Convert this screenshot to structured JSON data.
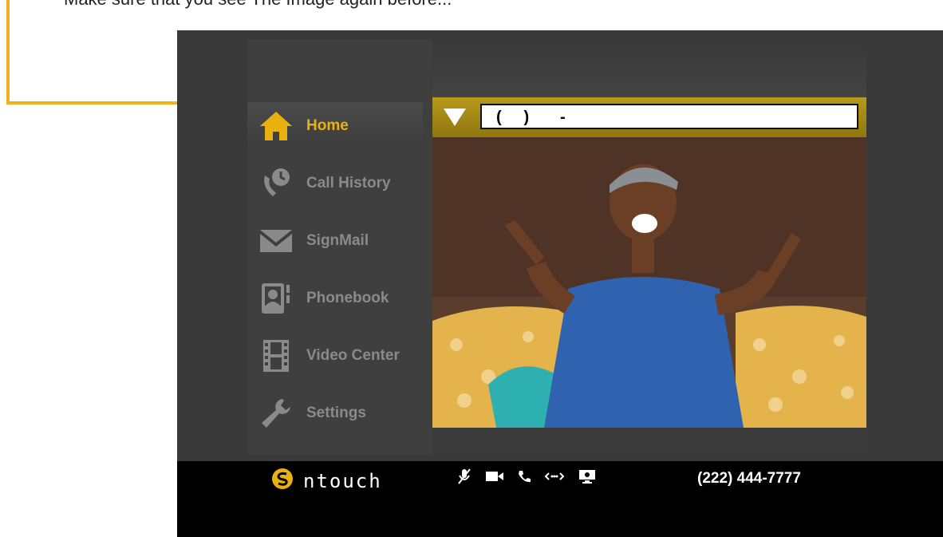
{
  "caption": {
    "text": "Make sure that you see The Image again before..."
  },
  "sidebar": {
    "items": [
      {
        "label": "Home",
        "icon": "home-icon",
        "active": true
      },
      {
        "label": "Call History",
        "icon": "call-history-icon"
      },
      {
        "label": "SignMail",
        "icon": "envelope-icon"
      },
      {
        "label": "Phonebook",
        "icon": "phonebook-icon"
      },
      {
        "label": "Video Center",
        "icon": "film-icon"
      },
      {
        "label": "Settings",
        "icon": "wrench-icon"
      }
    ]
  },
  "dial": {
    "format": "(     )       -",
    "value": ""
  },
  "statusbar": {
    "brand": "ntouch",
    "icons": [
      "mic-muted-icon",
      "video-camera-icon",
      "phone-icon",
      "network-icon",
      "remote-display-icon"
    ],
    "phone_number": "(222) 444-7777"
  },
  "colors": {
    "accent": "#e9b10e",
    "arrow": "#f2b01d",
    "bar": "#a48a16"
  }
}
